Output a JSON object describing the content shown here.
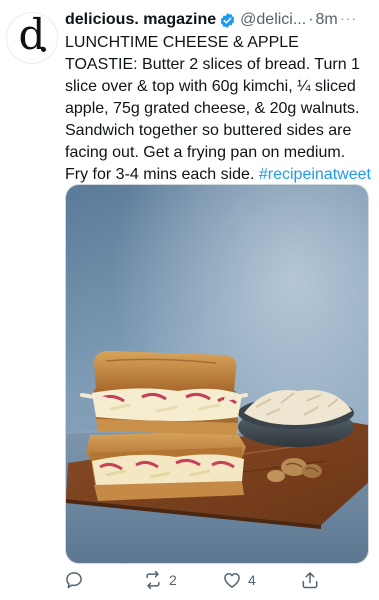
{
  "tweet": {
    "display_name": "delicious. magazine",
    "handle": "@delici...",
    "separator": "·",
    "time": "8m",
    "more_label": "···",
    "avatar_letter": "d",
    "text": "LUNCHTIME CHEESE & APPLE TOASTIE: Butter 2 slices of bread. Turn 1 slice over & top with 60g kimchi, ¼ sliced apple, 75g grated cheese, & 20g walnuts. Sandwich together so buttered sides are facing out. Get a frying pan on medium. Fry for 3-4 mins each side.",
    "hashtag": "#recipeinatweet",
    "media_icon": "toastie-photo"
  },
  "actions": {
    "reply": {
      "icon": "reply-icon",
      "count": ""
    },
    "retweet": {
      "icon": "retweet-icon",
      "count": "2"
    },
    "like": {
      "icon": "heart-icon",
      "count": "4"
    },
    "share": {
      "icon": "share-icon"
    }
  },
  "colors": {
    "link": "#1d9bf0",
    "verified": "#1d9bf0",
    "muted": "#536471",
    "text": "#0f1419"
  }
}
